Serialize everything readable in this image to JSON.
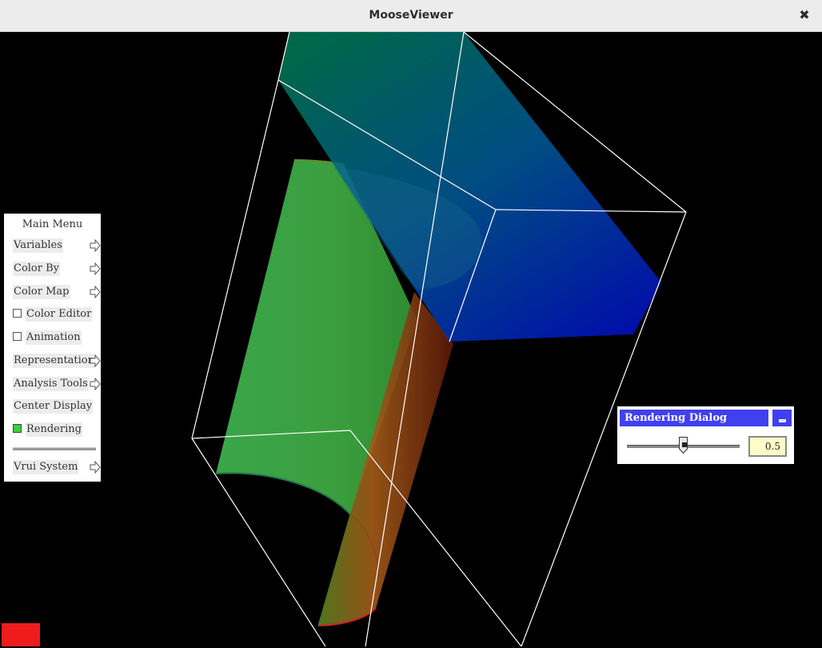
{
  "window": {
    "title": "MooseViewer",
    "close_glyph": "✖"
  },
  "main_menu": {
    "title": "Main Menu",
    "items": [
      {
        "label": "Variables",
        "kind": "submenu"
      },
      {
        "label": "Color By",
        "kind": "submenu"
      },
      {
        "label": "Color Map",
        "kind": "submenu"
      },
      {
        "label": "Color Editor",
        "kind": "checkbox",
        "checked": false
      },
      {
        "label": "Animation",
        "kind": "checkbox",
        "checked": false
      },
      {
        "label": "Representation",
        "kind": "submenu"
      },
      {
        "label": "Analysis Tools",
        "kind": "submenu"
      },
      {
        "label": "Center Display",
        "kind": "button"
      },
      {
        "label": "Rendering",
        "kind": "checkbox",
        "checked": true
      },
      {
        "label": "Vrui System",
        "kind": "submenu"
      }
    ]
  },
  "rendering_dialog": {
    "title": "Rendering Dialog",
    "opacity_value": "0.5",
    "slider_fraction": 0.5
  },
  "colors": {
    "dialog_title": "#4040f0",
    "checked": "#3bd13b",
    "corner_indicator": "#ee1c1c"
  }
}
